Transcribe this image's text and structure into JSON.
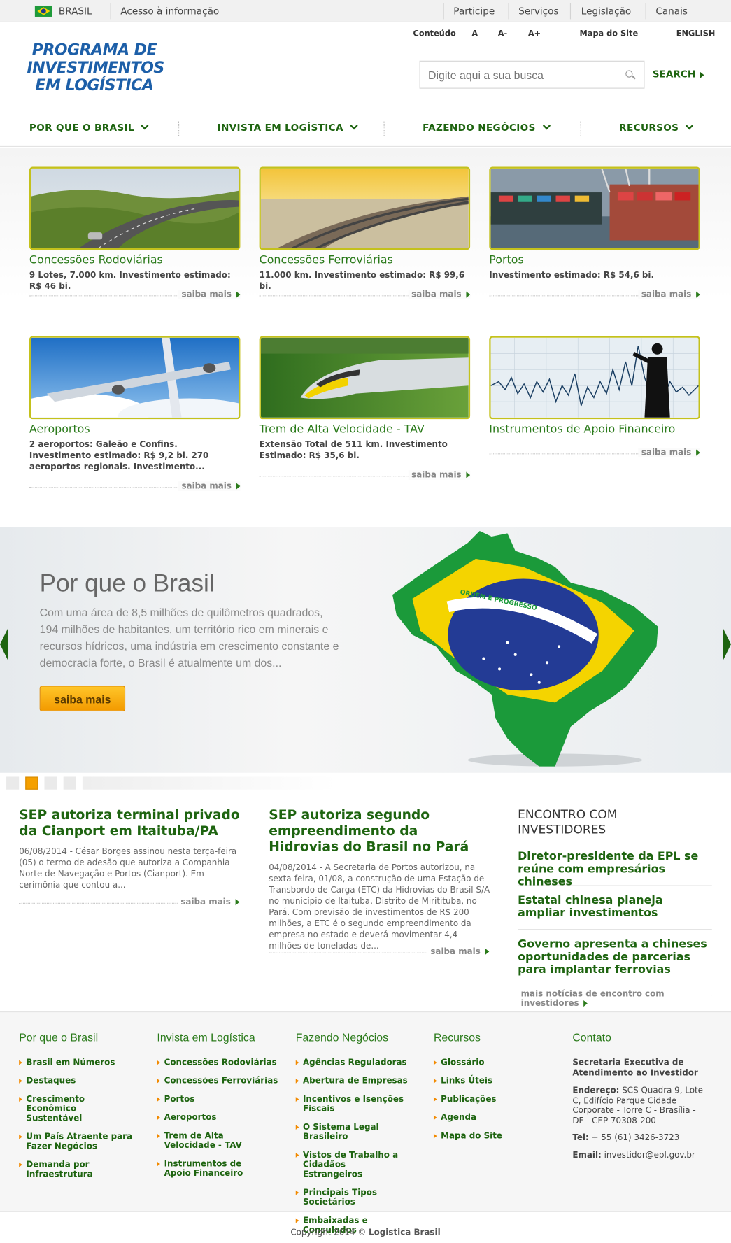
{
  "topbar": {
    "country": "BRASIL",
    "access": "Acesso à informação",
    "links": [
      "Participe",
      "Serviços",
      "Legislação",
      "Canais"
    ]
  },
  "header": {
    "logo_lines": [
      "PROGRAMA DE",
      "INVESTIMENTOS",
      "EM LOGÍSTICA"
    ],
    "util": {
      "content": "Conteúdo",
      "a": "A",
      "a_minus": "A-",
      "a_plus": "A+",
      "sitemap": "Mapa do Site",
      "english": "ENGLISH"
    },
    "search": {
      "placeholder": "Digite aqui a sua busca",
      "button": "SEARCH"
    }
  },
  "nav": [
    "POR QUE O BRASIL",
    "INVISTA EM LOGÍSTICA",
    "FAZENDO NEGÓCIOS",
    "RECURSOS"
  ],
  "cards": [
    {
      "title": "Concessões Rodoviárias",
      "desc": "9 Lotes, 7.000 km. Investimento estimado: R$ 46 bi.",
      "more": "saiba mais"
    },
    {
      "title": "Concessões Ferroviárias",
      "desc": "11.000 km. Investimento estimado: R$ 99,6 bi.",
      "more": "saiba mais"
    },
    {
      "title": "Portos",
      "desc": "Investimento estimado: R$ 54,6 bi.",
      "more": "saiba mais"
    },
    {
      "title": "Aeroportos",
      "desc": "2 aeroportos: Galeão e Confins. Investimento estimado: R$ 9,2 bi. 270 aeroportos regionais. Investimento...",
      "more": "saiba mais"
    },
    {
      "title": "Trem de Alta Velocidade - TAV",
      "desc": "Extensão Total de 511 km. Investimento Estimado: R$ 35,6 bi.",
      "more": "saiba mais"
    },
    {
      "title": "Instrumentos de Apoio Financeiro",
      "desc": "",
      "more": "saiba mais"
    }
  ],
  "hero": {
    "title": "Por que o Brasil",
    "text": "Com uma área de 8,5 milhões de quilômetros quadrados, 194 milhões de habitantes, um território rico em minerais e recursos hídricos, uma indústria em crescimento constante e democracia forte, o Brasil é atualmente um dos...",
    "button": "saiba mais",
    "flag_motto": "ORDEM E PROGRESSO"
  },
  "news": [
    {
      "title": "SEP autoriza terminal privado da Cianport em Itaituba/PA",
      "text": "06/08/2014 - César Borges assinou nesta terça-feira (05) o termo de adesão que autoriza a Companhia Norte de Navegação e Portos (Cianport). Em cerimônia que contou a...",
      "more": "saiba mais"
    },
    {
      "title": "SEP autoriza segundo empreendimento da Hidrovias do Brasil no Pará",
      "text": "04/08/2014 - A Secretaria de Portos autorizou, na sexta-feira, 01/08, a construção de uma Estação de Transbordo de Carga (ETC) da Hidrovias do Brasil S/A no município de Itaituba, Distrito de Miritituba, no Pará. Com previsão de investimentos de R$ 200 milhões, a ETC é o segundo empreendimento da empresa no estado e deverá movimentar 4,4 milhões de toneladas de...",
      "more": "saiba mais"
    }
  ],
  "encontro": {
    "title": "ENCONTRO COM INVESTIDORES",
    "items": [
      "Diretor-presidente da EPL se reúne com empresários chineses",
      "Estatal chinesa planeja ampliar investimentos",
      "Governo apresenta a chineses oportunidades de parcerias para implantar ferrovias"
    ],
    "more": "mais notícias de encontro com investidores"
  },
  "footer": {
    "cols": [
      {
        "title": "Por que o Brasil",
        "links": [
          "Brasil em Números",
          "Destaques",
          "Crescimento Econômico Sustentável",
          "Um País Atraente para Fazer Negócios",
          "Demanda por Infraestrutura"
        ]
      },
      {
        "title": "Invista em Logística",
        "links": [
          "Concessões Rodoviárias",
          "Concessões Ferroviárias",
          "Portos",
          "Aeroportos",
          "Trem de Alta Velocidade - TAV",
          "Instrumentos de Apoio Financeiro"
        ]
      },
      {
        "title": "Fazendo Negócios",
        "links": [
          "Agências Reguladoras",
          "Abertura de Empresas",
          "Incentivos e Isenções Fiscais",
          "O Sistema Legal Brasileiro",
          "Vistos de Trabalho a Cidadãos Estrangeiros",
          "Principais Tipos Societários",
          "Embaixadas e Consulados"
        ]
      },
      {
        "title": "Recursos",
        "links": [
          "Glossário",
          "Links Úteis",
          "Publicações",
          "Agenda",
          "Mapa do Site"
        ]
      }
    ],
    "contact": {
      "title": "Contato",
      "org": "Secretaria Executiva de Atendimento ao Investidor",
      "addr_label": "Endereço:",
      "addr": "SCS Quadra 9, Lote C, Edifício Parque Cidade Corporate - Torre C - Brasília - DF - CEP 70308-200",
      "tel_label": "Tel:",
      "tel": "+ 55 (61) 3426-3723",
      "email_label": "Email:",
      "email": "investidor@epl.gov.br"
    },
    "copyright": "Copyright 2014 © ",
    "copyright_brand": "Logistica Brasil"
  }
}
